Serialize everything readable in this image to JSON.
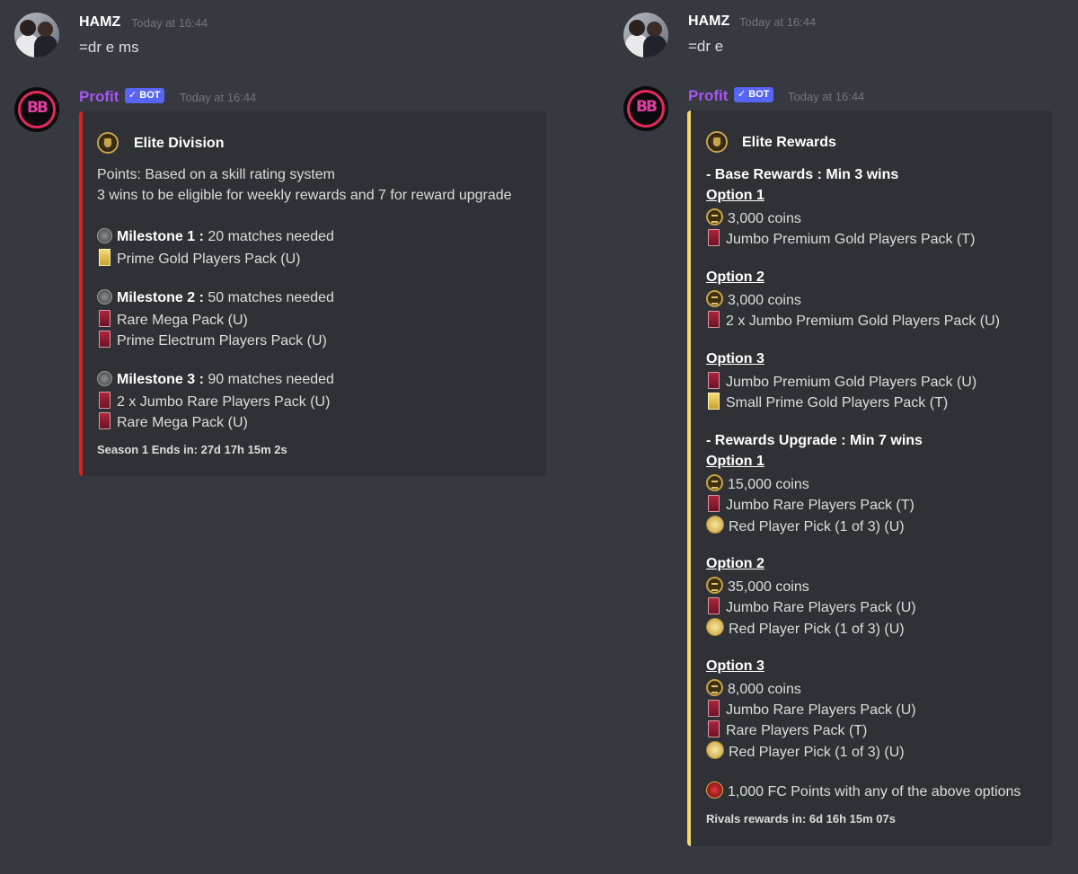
{
  "left": {
    "user": {
      "name": "HAMZ",
      "timestamp": "Today at 16:44",
      "message": "=dr e ms"
    },
    "bot": {
      "name": "Profit",
      "badge": "✓ BOT",
      "timestamp": "Today at 16:44"
    },
    "embed": {
      "color": "#e01e1e",
      "title": "Elite Division",
      "description": [
        "Points: Based on a skill rating system",
        "3 wins to be eligible for weekly rewards and 7 for reward upgrade"
      ],
      "milestones": [
        {
          "label": "Milestone 1 :",
          "requirement": "20 matches needed",
          "rewards": [
            {
              "icon": "gold-pack",
              "text": "Prime Gold Players Pack (U)"
            }
          ]
        },
        {
          "label": "Milestone 2 :",
          "requirement": "50 matches needed",
          "rewards": [
            {
              "icon": "red-pack",
              "text": "Rare Mega Pack (U)"
            },
            {
              "icon": "red-pack",
              "text": "Prime Electrum Players Pack (U)"
            }
          ]
        },
        {
          "label": "Milestone 3 :",
          "requirement": "90 matches needed",
          "rewards": [
            {
              "icon": "red-pack",
              "text": "2 x Jumbo Rare Players Pack (U)"
            },
            {
              "icon": "red-pack",
              "text": "Rare Mega Pack (U)"
            }
          ]
        }
      ],
      "footer": "Season 1 Ends in: 27d 17h 15m 2s"
    }
  },
  "right": {
    "user": {
      "name": "HAMZ",
      "timestamp": "Today at 16:44",
      "message": "=dr e"
    },
    "bot": {
      "name": "Profit",
      "badge": "✓ BOT",
      "timestamp": "Today at 16:44"
    },
    "embed": {
      "color": "#f5d66b",
      "title": "Elite Rewards",
      "base_header": "- Base Rewards : Min 3 wins",
      "base_options": [
        {
          "label": "Option 1",
          "items": [
            {
              "icon": "coin",
              "text": "3,000 coins"
            },
            {
              "icon": "red-pack",
              "text": "Jumbo Premium Gold Players Pack (T)"
            }
          ]
        },
        {
          "label": "Option 2",
          "items": [
            {
              "icon": "coin",
              "text": "3,000 coins"
            },
            {
              "icon": "red-pack",
              "text": "2 x Jumbo Premium Gold Players Pack (U)"
            }
          ]
        },
        {
          "label": "Option 3",
          "items": [
            {
              "icon": "red-pack",
              "text": "Jumbo Premium Gold Players Pack (U)"
            },
            {
              "icon": "gold-pack",
              "text": "Small Prime Gold Players Pack (T)"
            }
          ]
        }
      ],
      "upgrade_header": "- Rewards Upgrade : Min 7 wins",
      "upgrade_options": [
        {
          "label": "Option 1",
          "items": [
            {
              "icon": "coin",
              "text": "15,000 coins"
            },
            {
              "icon": "red-pack",
              "text": "Jumbo Rare Players Pack (T)"
            },
            {
              "icon": "player-pick",
              "text": "Red Player Pick (1 of 3) (U)"
            }
          ]
        },
        {
          "label": "Option 2",
          "items": [
            {
              "icon": "coin",
              "text": "35,000 coins"
            },
            {
              "icon": "red-pack",
              "text": "Jumbo Rare Players Pack (U)"
            },
            {
              "icon": "player-pick",
              "text": "Red Player Pick (1 of 3) (U)"
            }
          ]
        },
        {
          "label": "Option 3",
          "items": [
            {
              "icon": "coin",
              "text": "8,000 coins"
            },
            {
              "icon": "red-pack",
              "text": "Jumbo Rare Players Pack (U)"
            },
            {
              "icon": "red-pack",
              "text": "Rare Players Pack (T)"
            },
            {
              "icon": "player-pick",
              "text": "Red Player Pick (1 of 3) (U)"
            }
          ]
        }
      ],
      "fc_points": "1,000 FC Points with any of the above options",
      "footer": "Rivals rewards in: 6d 16h 15m 07s"
    }
  }
}
